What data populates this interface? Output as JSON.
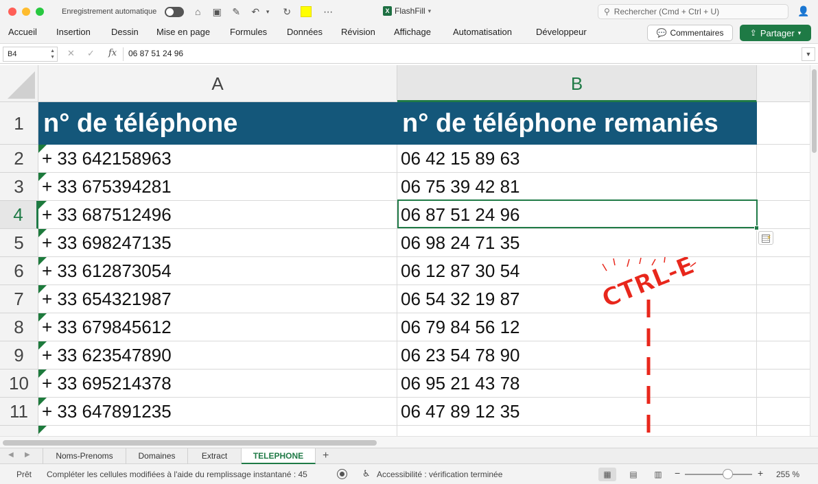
{
  "titlebar": {
    "autosave_label": "Enregistrement automatique",
    "document_title": "FlashFill",
    "search_placeholder": "Rechercher (Cmd + Ctrl + U)"
  },
  "ribbon": {
    "tabs": [
      "Accueil",
      "Insertion",
      "Dessin",
      "Mise en page",
      "Formules",
      "Données",
      "Révision",
      "Affichage",
      "Automatisation",
      "Développeur"
    ],
    "comments_label": "Commentaires",
    "share_label": "Partager"
  },
  "formula_bar": {
    "name_box": "B4",
    "fx_label": "fx",
    "content": "06 87 51 24 96"
  },
  "sheet": {
    "columns": [
      "A",
      "B"
    ],
    "rows": [
      {
        "num": "1",
        "a": "n° de téléphone",
        "b": "n° de téléphone remaniés"
      },
      {
        "num": "2",
        "a": "+ 33 642158963",
        "b": "06 42 15 89 63"
      },
      {
        "num": "3",
        "a": "+ 33 675394281",
        "b": "06 75 39 42 81"
      },
      {
        "num": "4",
        "a": "+ 33 687512496",
        "b": "06 87 51 24 96"
      },
      {
        "num": "5",
        "a": "+ 33 698247135",
        "b": "06 98 24 71 35"
      },
      {
        "num": "6",
        "a": "+ 33 612873054",
        "b": "06 12 87 30 54"
      },
      {
        "num": "7",
        "a": "+ 33 654321987",
        "b": "06 54 32 19 87"
      },
      {
        "num": "8",
        "a": "+ 33 679845612",
        "b": "06 79 84 56 12"
      },
      {
        "num": "9",
        "a": "+ 33 623547890",
        "b": "06 23 54 78 90"
      },
      {
        "num": "10",
        "a": "+ 33 695214378",
        "b": "06 95 21 43 78"
      },
      {
        "num": "11",
        "a": "+ 33 647891235",
        "b": "06 47 89 12 35"
      }
    ],
    "header_fill": "#14577a",
    "selection_color": "#1f7a46",
    "active_cell": "B4"
  },
  "annotation": {
    "stamp_text": "CTRL-E",
    "color": "#e8271c"
  },
  "sheet_tabs": {
    "tabs": [
      "Noms-Prenoms",
      "Domaines",
      "Extract",
      "TELEPHONE"
    ],
    "active": "TELEPHONE"
  },
  "statusbar": {
    "ready": "Prêt",
    "message": "Compléter les cellules modifiées à l'aide du remplissage instantané : 45",
    "accessibility": "Accessibilité : vérification terminée",
    "zoom_label": "255 %",
    "zoom_percent": 255
  }
}
